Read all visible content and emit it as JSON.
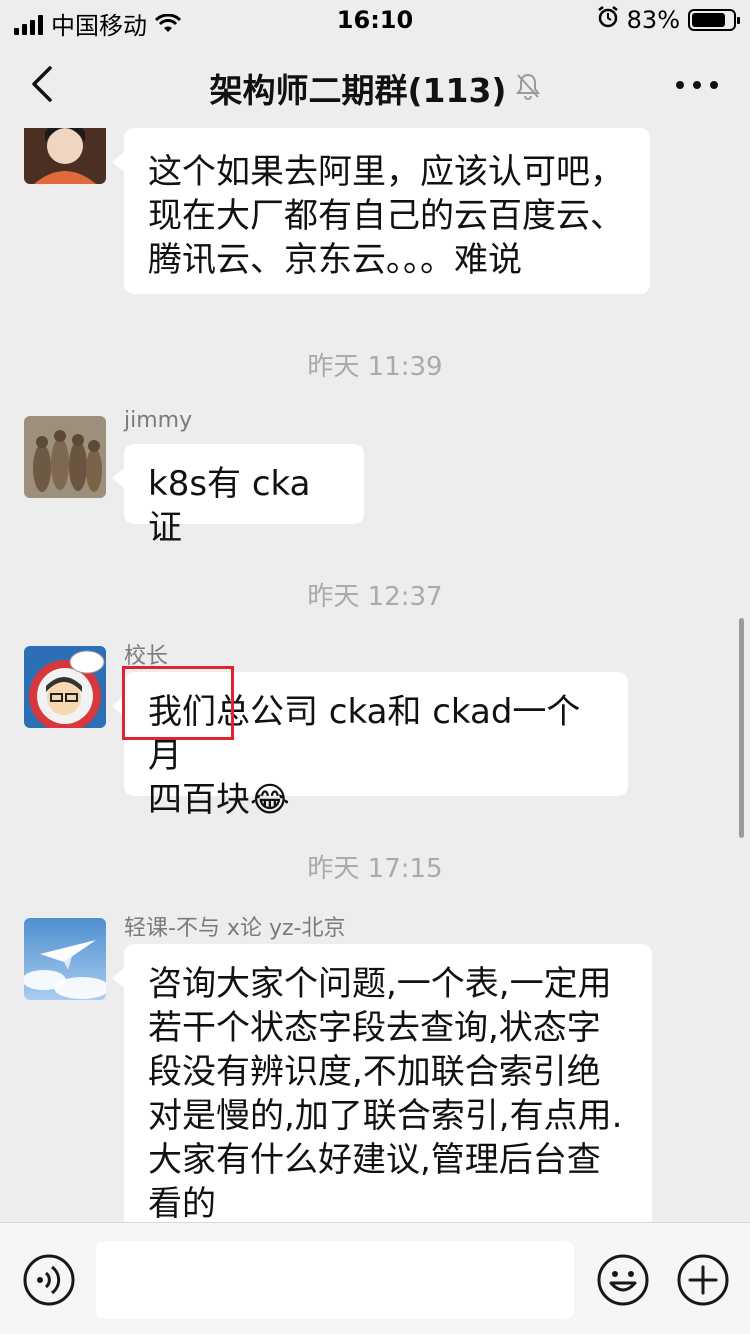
{
  "status_bar": {
    "carrier": "中国移动",
    "time": "16:10",
    "battery": "83%",
    "battery_level": 0.83,
    "icons": [
      "signal-icon",
      "wifi-icon",
      "alarm-icon",
      "battery-icon"
    ]
  },
  "header": {
    "title": "架构师二期群(113)",
    "icons": [
      "back-icon",
      "mute-bell-icon",
      "more-icon"
    ]
  },
  "messages": [
    {
      "type": "message",
      "sender": "",
      "lines": [
        "这个如果去阿里，应该认可吧，",
        "现在大厂都有自己的云百度云、",
        "腾讯云、京东云。。。难说"
      ]
    },
    {
      "type": "time",
      "text": "昨天 11:39"
    },
    {
      "type": "message",
      "sender": "jimmy",
      "lines": [
        "k8s有 cka证"
      ]
    },
    {
      "type": "time",
      "text": "昨天 12:37"
    },
    {
      "type": "message",
      "sender": "校长",
      "lines": [
        "我们总公司 cka和 ckad一个月",
        "四百块😂"
      ]
    },
    {
      "type": "time",
      "text": "昨天 17:15"
    },
    {
      "type": "message",
      "sender": "轻课-不与 x论 yz-北京",
      "lines": [
        "咨询大家个问题,一个表,一定用",
        "若干个状态字段去查询,状态字",
        "段没有辨识度,不加联合索引绝",
        "对是慢的,加了联合索引,有点用.",
        "大家有什么好建议,管理后台查",
        "看的"
      ]
    }
  ],
  "input_bar": {
    "icons": [
      "voice-icon",
      "emoji-icon",
      "plus-icon"
    ]
  },
  "colors": {
    "background": "#ededed",
    "bubble": "#ffffff",
    "highlight": "#e0262c"
  }
}
